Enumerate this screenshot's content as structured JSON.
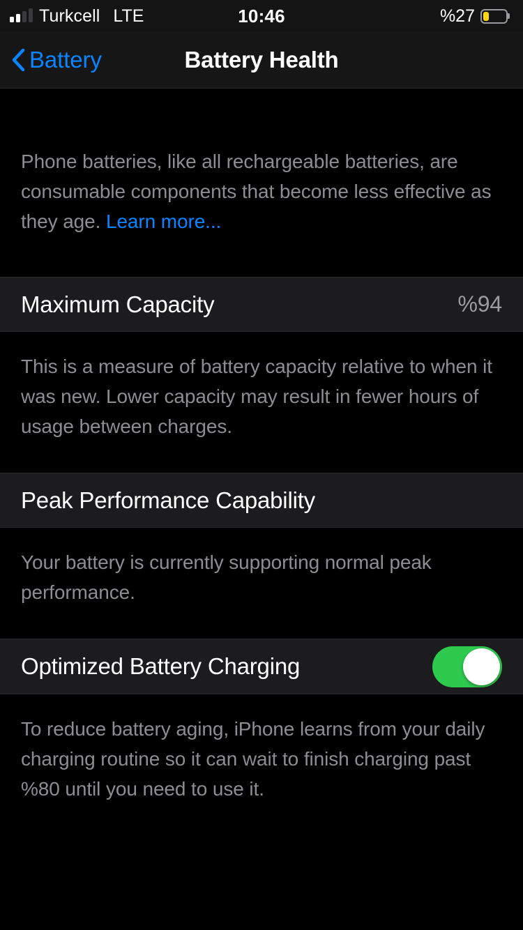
{
  "status_bar": {
    "carrier": "Turkcell",
    "network_type": "LTE",
    "time": "10:46",
    "battery_percent_label": "%27",
    "battery_level": 27,
    "battery_color": "#ffd60a",
    "signal_bars_filled": 2,
    "signal_bars_total": 4
  },
  "nav": {
    "back_label": "Battery",
    "title": "Battery Health",
    "accent_color": "#0a84ff"
  },
  "intro": {
    "text": "Phone batteries, like all rechargeable batteries, are consumable components that become less effective as they age. ",
    "link_label": "Learn more..."
  },
  "maximum_capacity": {
    "label": "Maximum Capacity",
    "value": "%94"
  },
  "maximum_capacity_footer": {
    "text": "This is a measure of battery capacity relative to when it was new. Lower capacity may result in fewer hours of usage between charges."
  },
  "peak_performance": {
    "label": "Peak Performance Capability"
  },
  "peak_performance_footer": {
    "text": "Your battery is currently supporting normal peak performance."
  },
  "optimized_charging": {
    "label": "Optimized Battery Charging",
    "enabled": true,
    "toggle_on_color": "#2eca4e"
  },
  "optimized_charging_footer": {
    "text": "To reduce battery aging, iPhone learns from your daily charging routine so it can wait to finish charging past %80 until you need to use it."
  }
}
